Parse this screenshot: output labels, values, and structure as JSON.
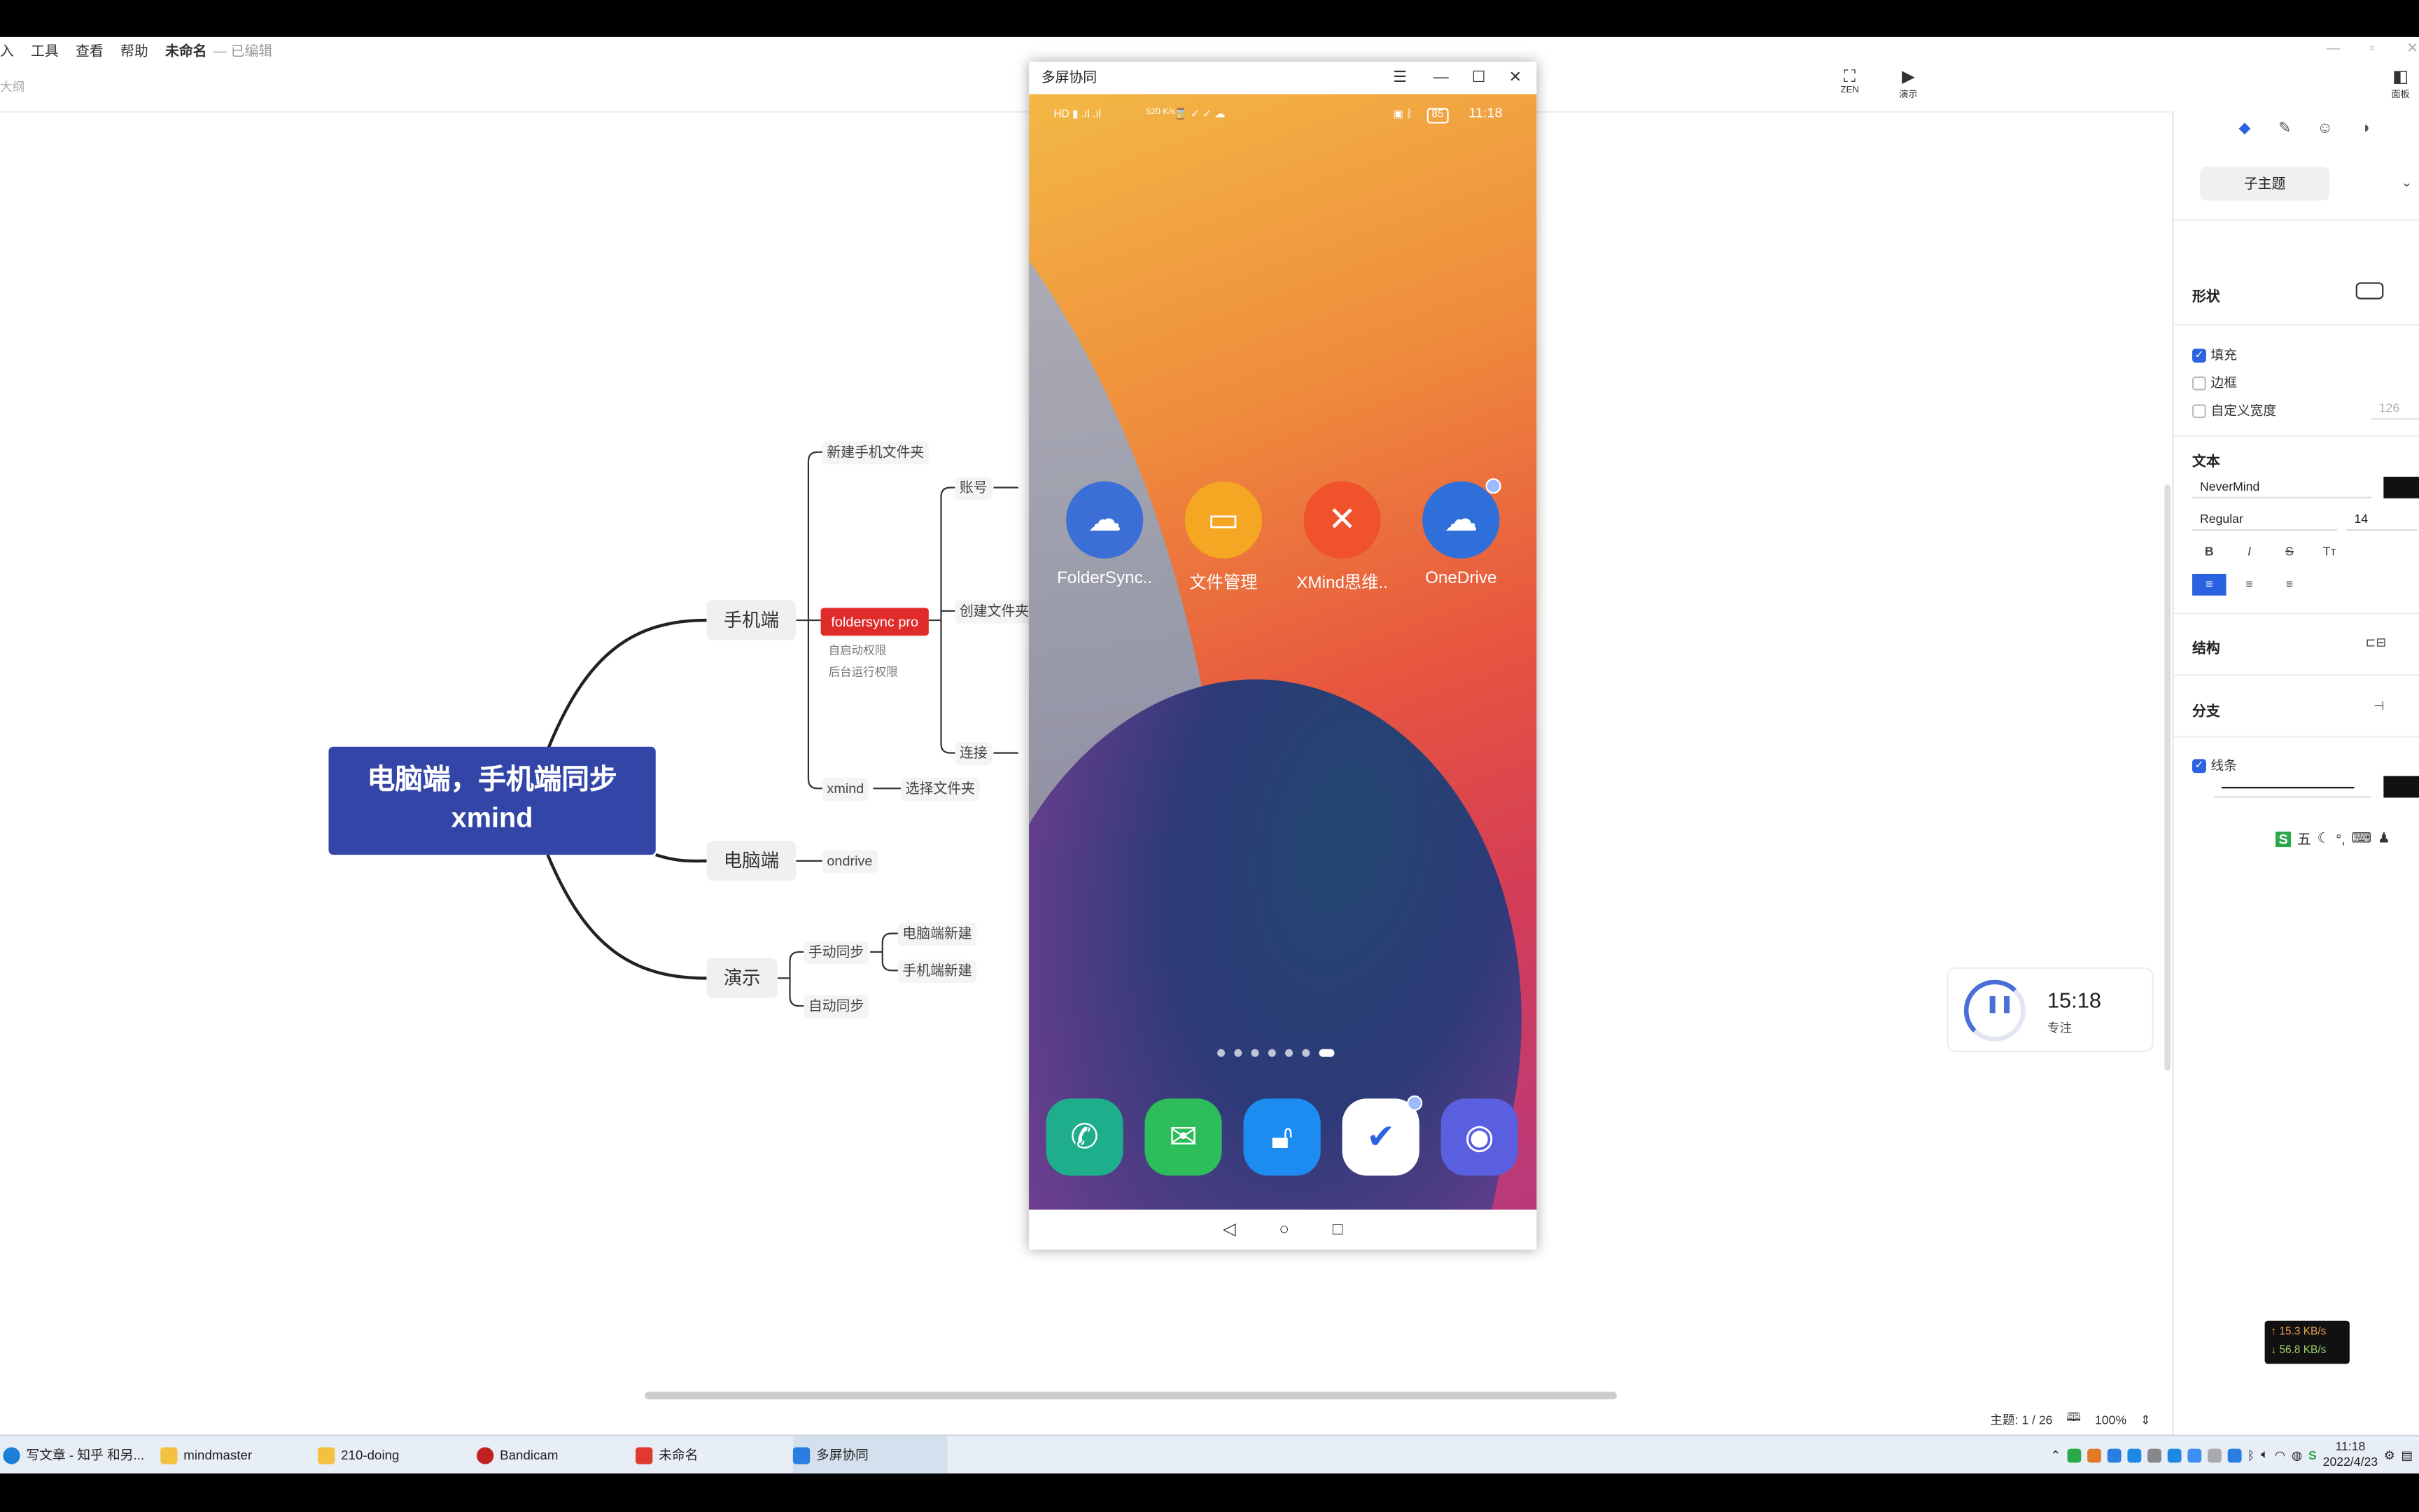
{
  "app": {
    "menu": [
      "入",
      "工具",
      "查看",
      "帮助"
    ],
    "doc_name": "未命名",
    "doc_status": "— 已编辑",
    "sub_hint": "大纲",
    "zen_label": "ZEN",
    "present_label": "演示",
    "panel_label": "面板"
  },
  "mindmap": {
    "central": [
      "电脑端，手机端同步",
      "xmind"
    ],
    "main": {
      "phone": "手机端",
      "pc": "电脑端",
      "demo": "演示"
    },
    "phone_branch": {
      "new_folder": "新建手机文件夹",
      "foldersync": "foldersync pro",
      "note1": "自启动权限",
      "note2": "后台运行权限",
      "account": "账号",
      "create_folder": "创建文件夹",
      "connect": "连接",
      "xmind": "xmind",
      "choose_folder": "选择文件夹"
    },
    "pc_branch": {
      "ondrive": "ondrive"
    },
    "demo_branch": {
      "manual": "手动同步",
      "pc_new": "电脑端新建",
      "phone_new": "手机端新建",
      "auto": "自动同步"
    }
  },
  "panel": {
    "subtopic": "子主题",
    "shape_label": "形状",
    "fill_label": "填充",
    "border_label": "边框",
    "custom_width_label": "自定义宽度",
    "custom_width_value": "126",
    "text_label": "文本",
    "font": "NeverMind",
    "weight": "Regular",
    "size": "14",
    "structure_label": "结构",
    "branch_label": "分支",
    "line_label": "线条",
    "ime": "五"
  },
  "timer": {
    "time": "15:18",
    "label": "专注"
  },
  "netspeed": {
    "up": "↑ 15.3 KB/s",
    "down": "↓ 56.8 KB/s"
  },
  "statusbar": {
    "topics": "主题: 1 / 26",
    "zoom": "100%"
  },
  "phone": {
    "window_title": "多屏协同",
    "status_time": "11:18",
    "status_speed": "520 K/s",
    "battery": "85",
    "apps": [
      {
        "label": "FolderSync..",
        "color": "#3b6fd6"
      },
      {
        "label": "文件管理",
        "color": "#f5a623"
      },
      {
        "label": "XMind思维..",
        "color": "#f0522c"
      },
      {
        "label": "OneDrive",
        "color": "#2f6fd9"
      }
    ],
    "dock": [
      {
        "name": "phone",
        "color": "#1fae8c"
      },
      {
        "name": "wechat",
        "color": "#2dbd5a"
      },
      {
        "name": "unlock",
        "color": "#1d8cf0"
      },
      {
        "name": "tasks",
        "color": "#ffffff"
      },
      {
        "name": "camera",
        "color": "#5a5fe0"
      }
    ]
  },
  "taskbar": {
    "items": [
      {
        "label": "写文章 - 知乎 和另...",
        "color": "#1e7fd8"
      },
      {
        "label": "mindmaster",
        "color": "#f3c140"
      },
      {
        "label": "210-doing",
        "color": "#f3c140"
      },
      {
        "label": "Bandicam",
        "color": "#c0201f"
      },
      {
        "label": "未命名",
        "color": "#e03a2c"
      },
      {
        "label": "多屏协同",
        "color": "#2a7de1"
      }
    ],
    "time": "11:18",
    "date": "2022/4/23"
  }
}
